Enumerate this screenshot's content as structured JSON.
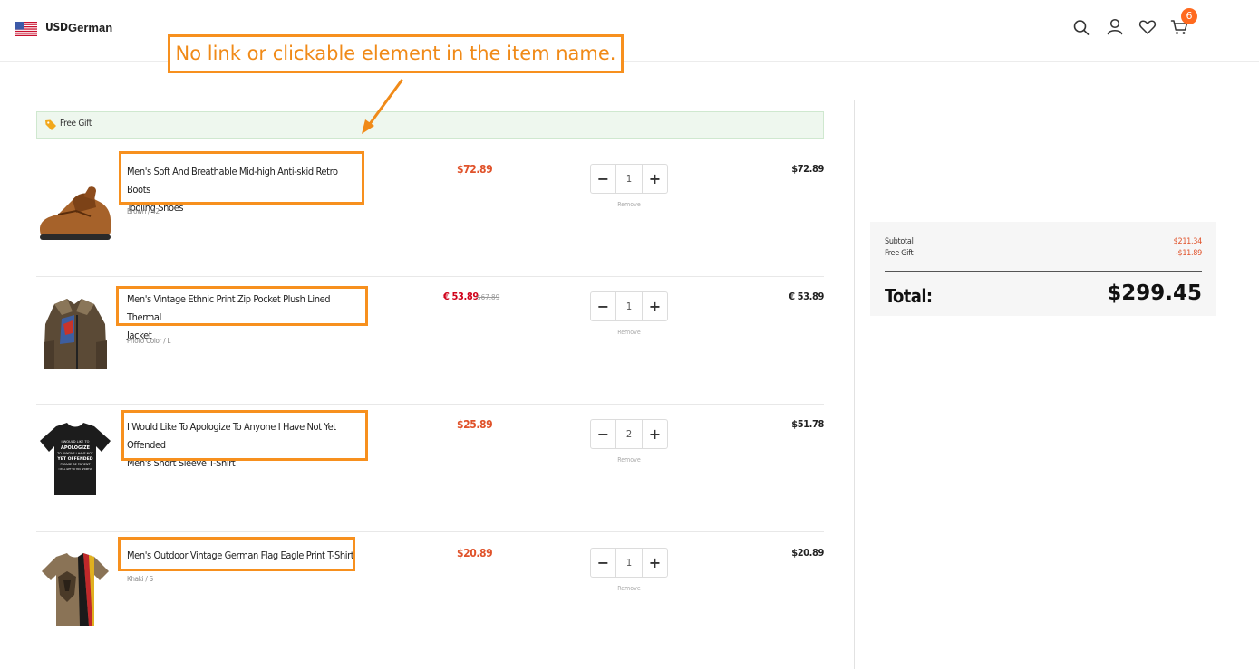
{
  "header": {
    "currency": "USD",
    "language": "German",
    "cart_count": "6",
    "icons": [
      "us-flag-icon",
      "search-icon",
      "user-icon",
      "heart-icon",
      "cart-icon"
    ]
  },
  "annotation": {
    "callout_text": "No link or clickable element in the item name.",
    "highlight_color": "#f7901e"
  },
  "gift_bar": {
    "label": "Free Gift"
  },
  "items": [
    {
      "name_line1": "Men's Soft And Breathable Mid-high Anti-skid Retro Boots",
      "name_line2": "Tooling Shoes",
      "variant": "Brown / 42",
      "price": "$72.89",
      "old_price": "",
      "quantity": "1",
      "remove_label": "Remove",
      "line_total": "$72.89",
      "thumb_icon": "boot-image"
    },
    {
      "name_line1": "Men's Vintage Ethnic Print Zip Pocket Plush Lined Thermal",
      "name_line2": "Jacket",
      "variant": "Photo Color / L",
      "price": "€ 53.89",
      "old_price": "$67.89",
      "quantity": "1",
      "remove_label": "Remove",
      "line_total": "€ 53.89",
      "thumb_icon": "jacket-image"
    },
    {
      "name_line1": "I Would Like To Apologize To Anyone I Have Not Yet Offended",
      "name_line2": "Men's Short Sleeve T-Shirt",
      "variant": "",
      "price": "$25.89",
      "old_price": "",
      "quantity": "2",
      "remove_label": "Remove",
      "line_total": "$51.78",
      "thumb_icon": "tshirt-black-image",
      "thumb_text": [
        "I WOULD LIKE TO",
        "APOLOGIZE",
        "TO ANYONE I HAVE NOT",
        "YET OFFENDED",
        "PLEASE BE PATIENT",
        "I WILL GET TO YOU SHORTLY"
      ]
    },
    {
      "name_line1": "Men's Outdoor Vintage German Flag Eagle Print T-Shirt",
      "name_line2": "",
      "variant": "Khaki / S",
      "price": "$20.89",
      "old_price": "",
      "quantity": "1",
      "remove_label": "Remove",
      "line_total": "$20.89",
      "thumb_icon": "tshirt-eagle-image"
    }
  ],
  "summary": {
    "subtotal_label": "Subtotal",
    "subtotal_value": "$211.34",
    "gift_label": "Free Gift",
    "gift_value": "-$11.89",
    "total_label": "Total:",
    "total_value": "$299.45"
  },
  "colors": {
    "price": "#e0522a",
    "sale_price": "#d0021b",
    "badge": "#ff6a1f",
    "annotation": "#f7901e",
    "gift_bar_bg": "#eef7ee"
  }
}
